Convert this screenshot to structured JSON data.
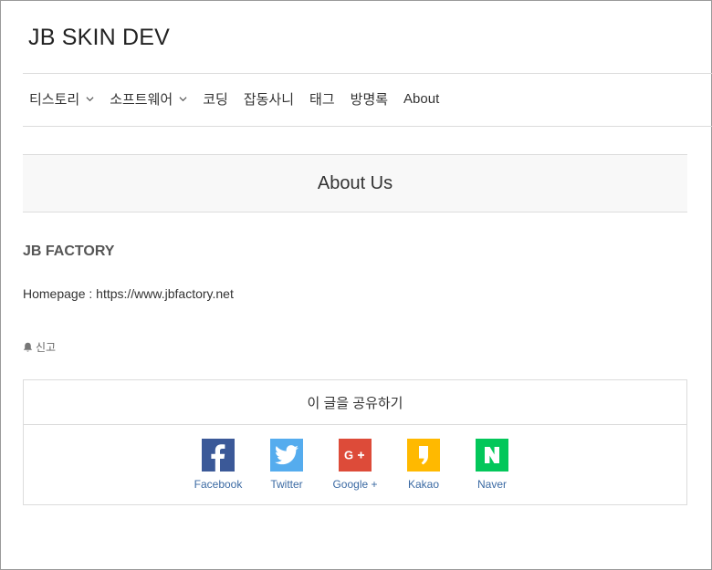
{
  "site": {
    "title": "JB SKIN DEV"
  },
  "nav": {
    "items": [
      {
        "label": "티스토리",
        "has_dropdown": true,
        "icon": "chevron-down-icon"
      },
      {
        "label": "소프트웨어",
        "has_dropdown": true,
        "icon": "chevron-down-icon"
      },
      {
        "label": "코딩"
      },
      {
        "label": "잡동사니"
      },
      {
        "label": "태그"
      },
      {
        "label": "방명록"
      },
      {
        "label": "About"
      }
    ]
  },
  "page": {
    "title": "About Us",
    "subtitle": "JB FACTORY",
    "homepage_text": "Homepage : https://www.jbfactory.net"
  },
  "report": {
    "label": "신고",
    "icon": "bell-icon"
  },
  "share": {
    "title": "이 글을 공유하기",
    "items": [
      {
        "label": "Facebook",
        "icon": "facebook-icon",
        "color": "#3b5998"
      },
      {
        "label": "Twitter",
        "icon": "twitter-icon",
        "color": "#55acee"
      },
      {
        "label": "Google +",
        "icon": "google-plus-icon",
        "color": "#dd4b39"
      },
      {
        "label": "Kakao",
        "icon": "kakao-icon",
        "color": "#ffb900"
      },
      {
        "label": "Naver",
        "icon": "naver-icon",
        "color": "#03c75a"
      }
    ]
  },
  "colors": {
    "link": "#3b6aa3",
    "border": "#dcdcdc",
    "header_bg": "#f8f8f8"
  }
}
